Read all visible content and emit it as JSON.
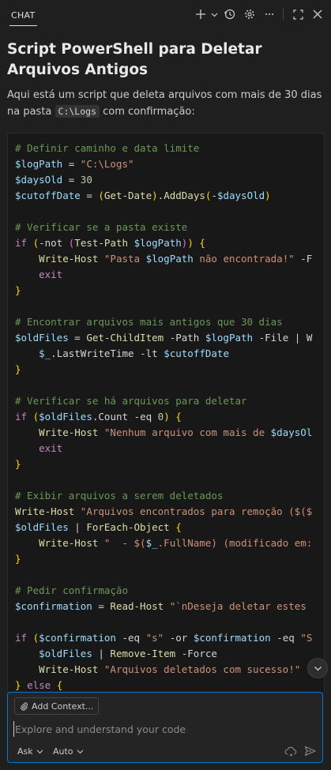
{
  "header": {
    "tab_label": "CHAT"
  },
  "toolbar": {
    "icons": [
      "plus-icon",
      "chevron-down-icon",
      "history-icon",
      "gear-icon",
      "more-icon",
      "maximize-icon",
      "close-icon"
    ]
  },
  "message": {
    "title": "Script PowerShell para Deletar Arquivos Antigos",
    "intro_before": "Aqui está um script que deleta arquivos com mais de 30 dias na pasta ",
    "intro_code": "C:\\Logs",
    "intro_after": " com confirmação:"
  },
  "code": {
    "language": "powershell",
    "lines": [
      "# Definir caminho e data limite",
      "$logPath = \"C:\\Logs\"",
      "$daysOld = 30",
      "$cutoffDate = (Get-Date).AddDays(-$daysOld)",
      "",
      "# Verificar se a pasta existe",
      "if (-not (Test-Path $logPath)) {",
      "    Write-Host \"Pasta $logPath não encontrada!\" -F",
      "    exit",
      "}",
      "",
      "# Encontrar arquivos mais antigos que 30 dias",
      "$oldFiles = Get-ChildItem -Path $logPath -File | W",
      "    $_.LastWriteTime -lt $cutoffDate",
      "}",
      "",
      "# Verificar se há arquivos para deletar",
      "if ($oldFiles.Count -eq 0) {",
      "    Write-Host \"Nenhum arquivo com mais de $daysOl",
      "    exit",
      "}",
      "",
      "# Exibir arquivos a serem deletados",
      "Write-Host \"Arquivos encontrados para remoção ($($",
      "$oldFiles | ForEach-Object {",
      "    Write-Host \"  - $($_.FullName) (modificado em:",
      "}",
      "",
      "# Pedir confirmação",
      "$confirmation = Read-Host \"`nDeseja deletar estes",
      "",
      "if ($confirmation -eq \"s\" -or $confirmation -eq \"S",
      "    $oldFiles | Remove-Item -Force",
      "    Write-Host \"Arquivos deletados com sucesso!\"",
      "} else {"
    ]
  },
  "input": {
    "context_button": "Add Context...",
    "placeholder": "Explore and understand your code",
    "mode": "Ask",
    "model": "Auto"
  }
}
